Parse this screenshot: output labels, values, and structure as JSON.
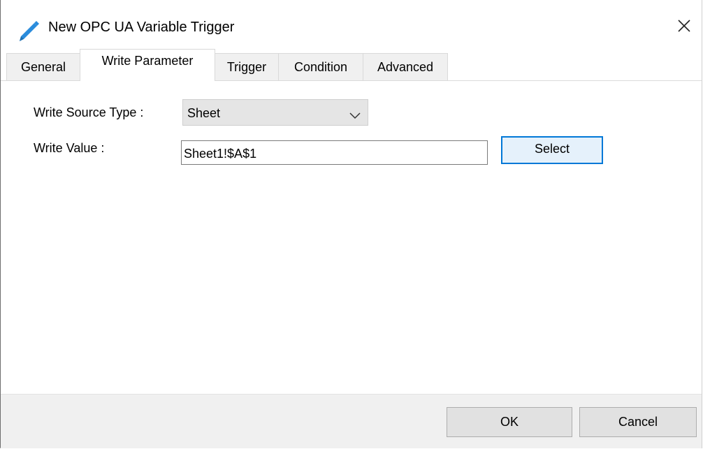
{
  "window": {
    "title": "New OPC UA Variable Trigger",
    "title_icon": "pencil-icon",
    "close_icon": "close-icon",
    "accent_color": "#2a8cdc"
  },
  "tabs": [
    {
      "label": "General",
      "active": false
    },
    {
      "label": "Write Parameter",
      "active": true
    },
    {
      "label": "Trigger",
      "active": false
    },
    {
      "label": "Condition",
      "active": false
    },
    {
      "label": "Advanced",
      "active": false
    }
  ],
  "form": {
    "write_source_type_label": "Write Source Type :",
    "write_source_type_value": "Sheet",
    "write_value_label": "Write Value :",
    "write_value": "Sheet1!$A$1",
    "select_button_label": "Select"
  },
  "footer": {
    "ok_label": "OK",
    "cancel_label": "Cancel"
  }
}
